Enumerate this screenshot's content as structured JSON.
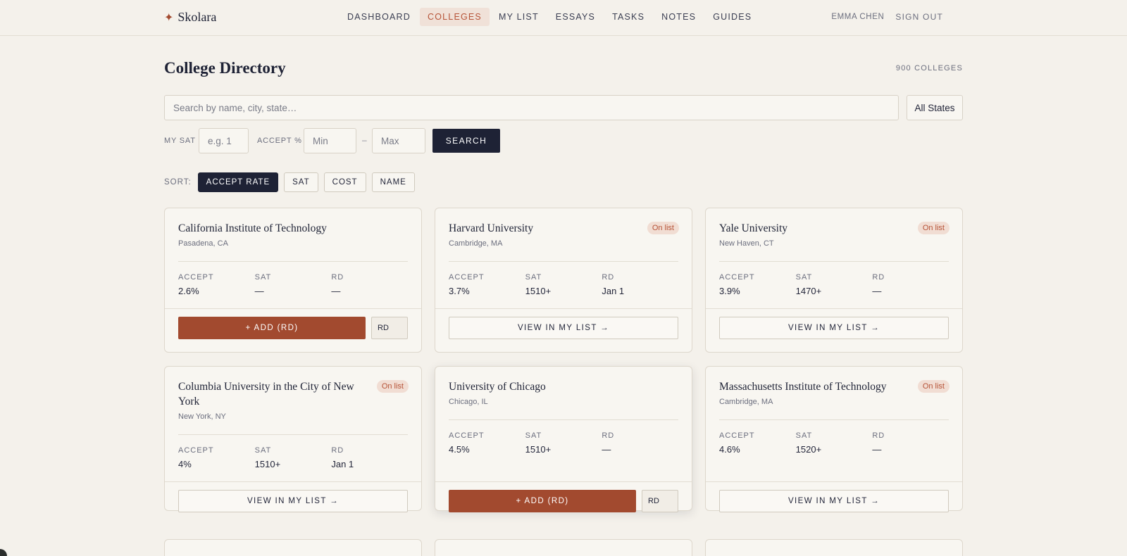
{
  "brand": {
    "icon": "star-icon",
    "name": "Skolara",
    "accent": "#a24a2f"
  },
  "nav": {
    "items": [
      "DASHBOARD",
      "COLLEGES",
      "MY LIST",
      "ESSAYS",
      "TASKS",
      "NOTES",
      "GUIDES"
    ],
    "active": "COLLEGES"
  },
  "user": {
    "name": "EMMA CHEN",
    "signout": "SIGN OUT"
  },
  "page": {
    "title": "College Directory",
    "count": "900 COLLEGES"
  },
  "search": {
    "placeholder": "Search by name, city, state…",
    "value": ""
  },
  "state_filter": {
    "selected": "All States"
  },
  "filters": {
    "sat_label": "MY SAT",
    "sat_placeholder": "e.g. 1",
    "accept_label": "ACCEPT %",
    "min_placeholder": "Min",
    "max_placeholder": "Max",
    "separator": "–",
    "search_button": "SEARCH"
  },
  "sort": {
    "label": "SORT:",
    "options": [
      "ACCEPT RATE",
      "SAT",
      "COST",
      "NAME"
    ],
    "active": "ACCEPT RATE"
  },
  "card_labels": {
    "accept": "ACCEPT",
    "sat": "SAT",
    "rd": "RD",
    "on_list": "On list",
    "add": "+ ADD (RD)",
    "rd_select": "RD",
    "view": "VIEW IN MY LIST →"
  },
  "colleges": [
    {
      "name": "California Institute of Technology",
      "location": "Pasadena, CA",
      "accept": "2.6%",
      "sat": "—",
      "rd": "—",
      "on_list": false
    },
    {
      "name": "Harvard University",
      "location": "Cambridge, MA",
      "accept": "3.7%",
      "sat": "1510+",
      "rd": "Jan 1",
      "on_list": true
    },
    {
      "name": "Yale University",
      "location": "New Haven, CT",
      "accept": "3.9%",
      "sat": "1470+",
      "rd": "—",
      "on_list": true
    },
    {
      "name": "Columbia University in the City of New York",
      "location": "New York, NY",
      "accept": "4%",
      "sat": "1510+",
      "rd": "Jan 1",
      "on_list": true
    },
    {
      "name": "University of Chicago",
      "location": "Chicago, IL",
      "accept": "4.5%",
      "sat": "1510+",
      "rd": "—",
      "on_list": false
    },
    {
      "name": "Massachusetts Institute of Technology",
      "location": "Cambridge, MA",
      "accept": "4.6%",
      "sat": "1520+",
      "rd": "—",
      "on_list": true
    }
  ],
  "colors": {
    "primary_dark": "#1e2235",
    "accent": "#a24a2f",
    "background": "#f4f1eb",
    "badge_bg": "#f1ddd3"
  }
}
